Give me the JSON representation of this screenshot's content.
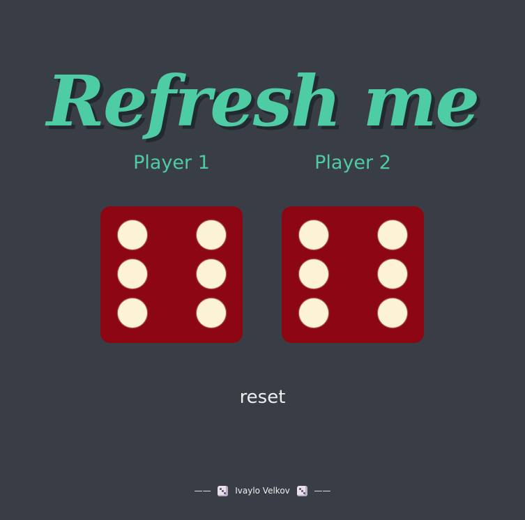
{
  "title": "Refresh me",
  "players": [
    {
      "label": "Player 1",
      "die_value": 6
    },
    {
      "label": "Player 2",
      "die_value": 6
    }
  ],
  "reset_label": "reset",
  "footer": {
    "left_dash": "——",
    "author": "Ivaylo Velkov",
    "right_dash": "——",
    "icon": "dice-icon"
  },
  "colors": {
    "background": "#393e46",
    "accent": "#4ecca3",
    "die": "#8d0613",
    "pip": "#fcf2d5",
    "text": "#eeeeee"
  }
}
